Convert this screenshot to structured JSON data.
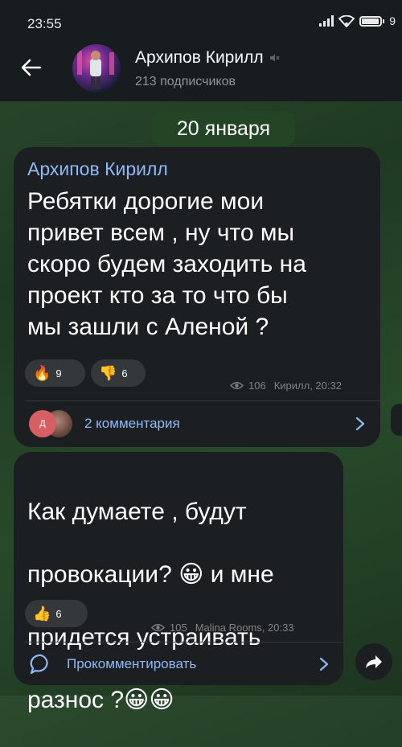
{
  "status_bar": {
    "time": "23:55",
    "battery_text": "9"
  },
  "header": {
    "title": "Архипов Кирилл",
    "subtitle": "213 подписчиков",
    "icons": [
      "back-arrow-icon",
      "mute-icon"
    ]
  },
  "date_chip": "20 января",
  "posts": [
    {
      "author": "Архипов Кирилл",
      "text": "Ребятки дорогие мои\nпривет всем , ну что мы\nскоро будем заходить на\nпроект кто за то что бы\nмы зашли с Аленой ?",
      "reactions": [
        {
          "emoji": "🔥",
          "count": "9"
        },
        {
          "emoji": "👎",
          "count": "6"
        }
      ],
      "views": "106",
      "signature": "Кирилл, 20:32",
      "comments_avatar_letter": "Д",
      "comments_label": "2 комментария"
    },
    {
      "text_lines": [
        "Как думаете , будут",
        "провокации? 😀 и мне",
        "придется устраивать",
        "разнос ?😀😀"
      ],
      "reactions": [
        {
          "emoji": "👍",
          "count": "6"
        }
      ],
      "views": "105",
      "signature": "Malina Rooms, 20:33",
      "comment_label": "Прокомментировать"
    }
  ],
  "colors": {
    "link": "#8fb9f6",
    "bubble": "#1c1f21",
    "header": "#171c1f",
    "date_chip": "#234526"
  }
}
